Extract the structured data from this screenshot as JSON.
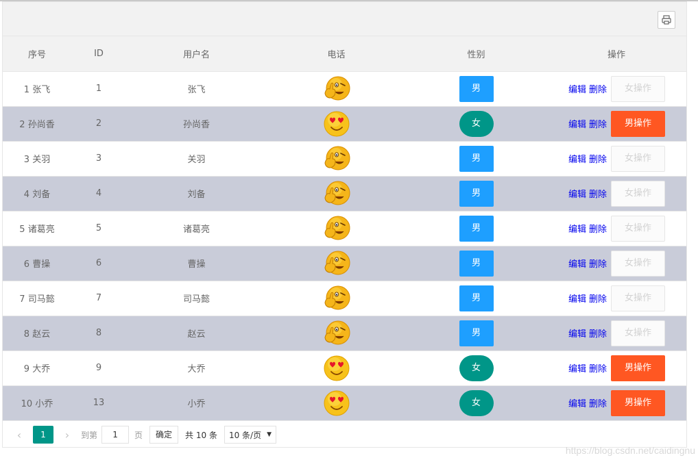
{
  "toolbar": {
    "print_icon": "printer-icon"
  },
  "table": {
    "headers": [
      "序号",
      "ID",
      "用户名",
      "电话",
      "性别",
      "操作"
    ],
    "rows": [
      {
        "seq": "1 张飞",
        "id": "1",
        "name": "张飞",
        "face": "wink",
        "sex": "男",
        "sex_type": "male",
        "edit": "编辑",
        "del": "删除",
        "op": "女操作",
        "op_enabled": false
      },
      {
        "seq": "2 孙尚香",
        "id": "2",
        "name": "孙尚香",
        "face": "love",
        "sex": "女",
        "sex_type": "female",
        "edit": "编辑",
        "del": "删除",
        "op": "男操作",
        "op_enabled": true
      },
      {
        "seq": "3 关羽",
        "id": "3",
        "name": "关羽",
        "face": "wink",
        "sex": "男",
        "sex_type": "male",
        "edit": "编辑",
        "del": "删除",
        "op": "女操作",
        "op_enabled": false
      },
      {
        "seq": "4 刘备",
        "id": "4",
        "name": "刘备",
        "face": "wink",
        "sex": "男",
        "sex_type": "male",
        "edit": "编辑",
        "del": "删除",
        "op": "女操作",
        "op_enabled": false
      },
      {
        "seq": "5 诸葛亮",
        "id": "5",
        "name": "诸葛亮",
        "face": "wink",
        "sex": "男",
        "sex_type": "male",
        "edit": "编辑",
        "del": "删除",
        "op": "女操作",
        "op_enabled": false
      },
      {
        "seq": "6 曹操",
        "id": "6",
        "name": "曹操",
        "face": "wink",
        "sex": "男",
        "sex_type": "male",
        "edit": "编辑",
        "del": "删除",
        "op": "女操作",
        "op_enabled": false
      },
      {
        "seq": "7 司马懿",
        "id": "7",
        "name": "司马懿",
        "face": "wink",
        "sex": "男",
        "sex_type": "male",
        "edit": "编辑",
        "del": "删除",
        "op": "女操作",
        "op_enabled": false
      },
      {
        "seq": "8 赵云",
        "id": "8",
        "name": "赵云",
        "face": "wink",
        "sex": "男",
        "sex_type": "male",
        "edit": "编辑",
        "del": "删除",
        "op": "女操作",
        "op_enabled": false
      },
      {
        "seq": "9 大乔",
        "id": "9",
        "name": "大乔",
        "face": "love",
        "sex": "女",
        "sex_type": "female",
        "edit": "编辑",
        "del": "删除",
        "op": "男操作",
        "op_enabled": true
      },
      {
        "seq": "10 小乔",
        "id": "13",
        "name": "小乔",
        "face": "love",
        "sex": "女",
        "sex_type": "female",
        "edit": "编辑",
        "del": "删除",
        "op": "男操作",
        "op_enabled": true
      }
    ]
  },
  "pager": {
    "prev": "‹",
    "current": "1",
    "next": "›",
    "goto_label": "到第",
    "goto_value": "1",
    "page_label": "页",
    "confirm": "确定",
    "total": "共 10 条",
    "per_page": "10 条/页"
  },
  "watermark": "https://blog.csdn.net/caidingnu",
  "colors": {
    "male": "#1e9fff",
    "female": "#009688",
    "active_op": "#ff5722",
    "alt_row": "#c9ccd9"
  }
}
